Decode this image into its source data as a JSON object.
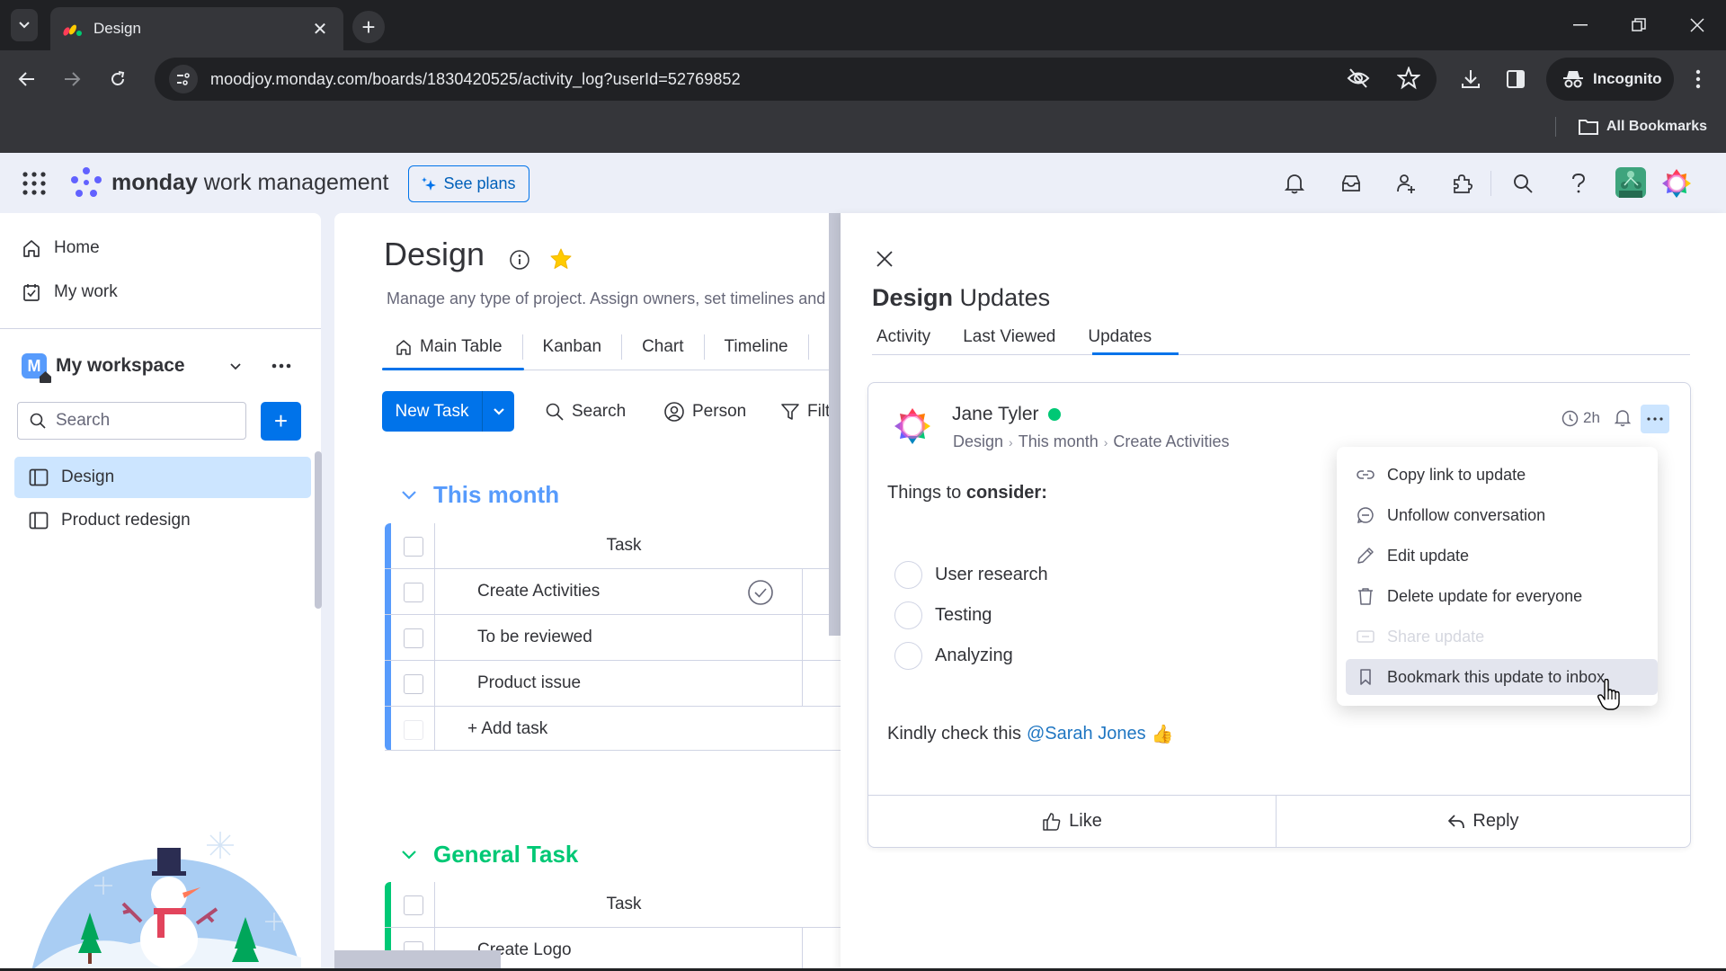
{
  "browser": {
    "tab_title": "Design",
    "new_tab_label": "+",
    "url": "moodjoy.monday.com/boards/1830420525/activity_log?userId=52769852",
    "incognito_label": "Incognito",
    "bookmarks_label": "All Bookmarks"
  },
  "app_header": {
    "brand_bold": "monday",
    "brand_rest": " work management",
    "see_plans_label": "See plans"
  },
  "sidebar": {
    "links": [
      {
        "label": "Home",
        "icon": "home-icon"
      },
      {
        "label": "My work",
        "icon": "calendar-check-icon"
      }
    ],
    "workspace": {
      "badge": "M",
      "name": "My workspace"
    },
    "search_placeholder": "Search",
    "add_label": "+",
    "boards": [
      {
        "label": "Design",
        "active": true
      },
      {
        "label": "Product redesign",
        "active": false
      }
    ]
  },
  "board": {
    "title": "Design",
    "description": "Manage any type of project. Assign owners, set timelines and keep track of where your project stands.",
    "views": [
      {
        "label": "Main Table",
        "active": true
      },
      {
        "label": "Kanban"
      },
      {
        "label": "Chart"
      },
      {
        "label": "Timeline"
      },
      {
        "label": "+"
      }
    ],
    "new_task_label": "New Task",
    "tools": {
      "search": "Search",
      "person": "Person",
      "filter": "Filter"
    },
    "groups": [
      {
        "title": "This month",
        "color": "#579bfc",
        "column_header": "Task",
        "rows": [
          "Create Activities",
          "To be reviewed",
          "Product issue"
        ],
        "add_label": "+ Add task"
      },
      {
        "title": "General Task",
        "color": "#00c875",
        "column_header": "Task",
        "rows": [
          "Create Logo"
        ]
      }
    ]
  },
  "updates_panel": {
    "title_bold": "Design",
    "title_rest": "Updates",
    "tabs": [
      {
        "label": "Activity"
      },
      {
        "label": "Last Viewed"
      },
      {
        "label": "Updates",
        "active": true
      }
    ],
    "update": {
      "author": "Jane Tyler",
      "online": true,
      "breadcrumb": [
        "Design",
        "This month",
        "Create Activities"
      ],
      "time": "2h",
      "heading_normal": "Things to ",
      "heading_bold": "consider:",
      "checklist": [
        "User research",
        "Testing",
        "Analyzing"
      ],
      "message_prefix": "Kindly check this",
      "mention": "@Sarah Jones",
      "emoji": "👍",
      "like_label": "Like",
      "reply_label": "Reply"
    },
    "menu": [
      {
        "label": "Copy link to update",
        "icon": "link-icon",
        "state": "normal"
      },
      {
        "label": "Unfollow conversation",
        "icon": "unfollow-icon",
        "state": "normal"
      },
      {
        "label": "Edit update",
        "icon": "pencil-icon",
        "state": "normal"
      },
      {
        "label": "Delete update for everyone",
        "icon": "trash-icon",
        "state": "normal"
      },
      {
        "label": "Share update",
        "icon": "share-icon",
        "state": "disabled"
      },
      {
        "label": "Bookmark this update to inbox",
        "icon": "bookmark-icon",
        "state": "hover"
      }
    ]
  },
  "colors": {
    "primary": "#0073ea",
    "online": "#00c875",
    "group_this_month": "#579bfc",
    "group_general": "#00c875",
    "mention": "#1f76c2"
  }
}
